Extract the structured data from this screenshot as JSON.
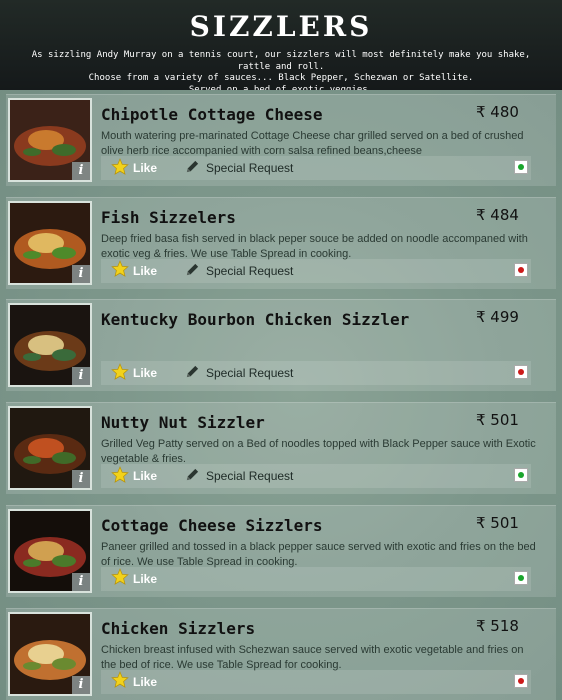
{
  "header": {
    "title": "SIZZLERS",
    "description": "As sizzling Andy Murray on a tennis court, our sizzlers will most definitely make you shake, rattle and roll.\nChoose from a variety of sauces... Black Pepper, Schezwan or Satellite.\nServed on a bed of exotic veggies."
  },
  "labels": {
    "like": "Like",
    "special_request": "Special Request",
    "info": "i"
  },
  "colors": {
    "veg": "#1aa52c",
    "non_veg": "#cc1a1a"
  },
  "items": [
    {
      "name": "Chipotle Cottage Cheese",
      "price": "₹ 480",
      "description": "Mouth watering pre-marinated Cottage Cheese char grilled served on a bed of crushed olive herb rice accompanied with corn salsa refined beans,cheese",
      "diet": "veg",
      "has_special_request": true
    },
    {
      "name": "Fish Sizzelers",
      "price": "₹ 484",
      "description": "Deep fried basa fish served in black peper souce be added on noodle accompaned with exotic veg & fries. We use Table Spread in cooking.",
      "diet": "non-veg",
      "has_special_request": true
    },
    {
      "name": "Kentucky Bourbon Chicken Sizzler",
      "price": "₹ 499",
      "description": "",
      "diet": "non-veg",
      "has_special_request": true
    },
    {
      "name": "Nutty Nut Sizzler",
      "price": "₹ 501",
      "description": "Grilled Veg Patty served on a Bed of noodles topped with Black Pepper sauce with Exotic vegetable & fries.",
      "diet": "veg",
      "has_special_request": true
    },
    {
      "name": "Cottage Cheese Sizzlers",
      "price": "₹ 501",
      "description": "Paneer grilled and tossed in a black pepper sauce served with exotic and fries on the bed of rice. We use Table Spread in cooking.",
      "diet": "veg",
      "has_special_request": false
    },
    {
      "name": "Chicken Sizzlers",
      "price": "₹ 518",
      "description": "Chicken breast infused with Schezwan sauce served with exotic vegetable and fries on the bed of rice. We use Table Spread for cooking.",
      "diet": "non-veg",
      "has_special_request": false
    }
  ]
}
